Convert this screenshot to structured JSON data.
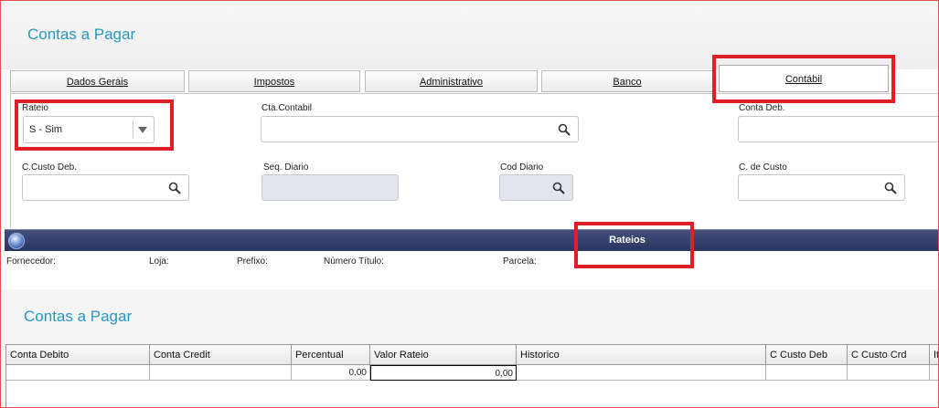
{
  "page": {
    "title": "Contas a Pagar"
  },
  "tabs": [
    {
      "label": "Dados Gerais"
    },
    {
      "label": "Impostos"
    },
    {
      "label": "Administrativo"
    },
    {
      "label": "Banco"
    },
    {
      "label": "Contábil",
      "active": true
    }
  ],
  "form": {
    "rateio": {
      "label": "Rateio",
      "value": "S - Sim"
    },
    "cta_contabil": {
      "label": "Cta.Contabil",
      "value": ""
    },
    "conta_deb": {
      "label": "Conta Deb.",
      "value": ""
    },
    "ccusto_deb": {
      "label": "C.Custo Deb.",
      "value": ""
    },
    "seq_diario": {
      "label": "Seq. Diario",
      "value": ""
    },
    "cod_diario": {
      "label": "Cod Diario",
      "value": ""
    },
    "c_de_custo": {
      "label": "C. de Custo",
      "value": ""
    }
  },
  "dialog": {
    "title": "Rateios",
    "info": {
      "fornecedor": "Fornecedor:",
      "loja": "Loja:",
      "prefixo": "Prefixo:",
      "numero_titulo": "Número Título:",
      "parcela": "Parcela:"
    },
    "subtitle": "Contas a Pagar",
    "grid": {
      "columns": [
        "Conta Debito",
        "Conta Credit",
        "Percentual",
        "Valor Rateio",
        "Historico",
        "C Custo Deb",
        "C Custo Crd",
        "It"
      ],
      "rows": [
        {
          "conta_debito": "",
          "conta_credit": "",
          "percentual": "0,00",
          "valor_rateio": "0,00",
          "historico": "",
          "c_custo_deb": "",
          "c_custo_crd": "",
          "it": ""
        }
      ]
    }
  },
  "colors": {
    "accent": "#2a97c1",
    "highlight": "#e01e26",
    "dialog_bar": "#333d6a"
  },
  "icons": {
    "search": "search-icon",
    "dropdown": "chevron-down-icon",
    "dialog": "globe-icon"
  }
}
